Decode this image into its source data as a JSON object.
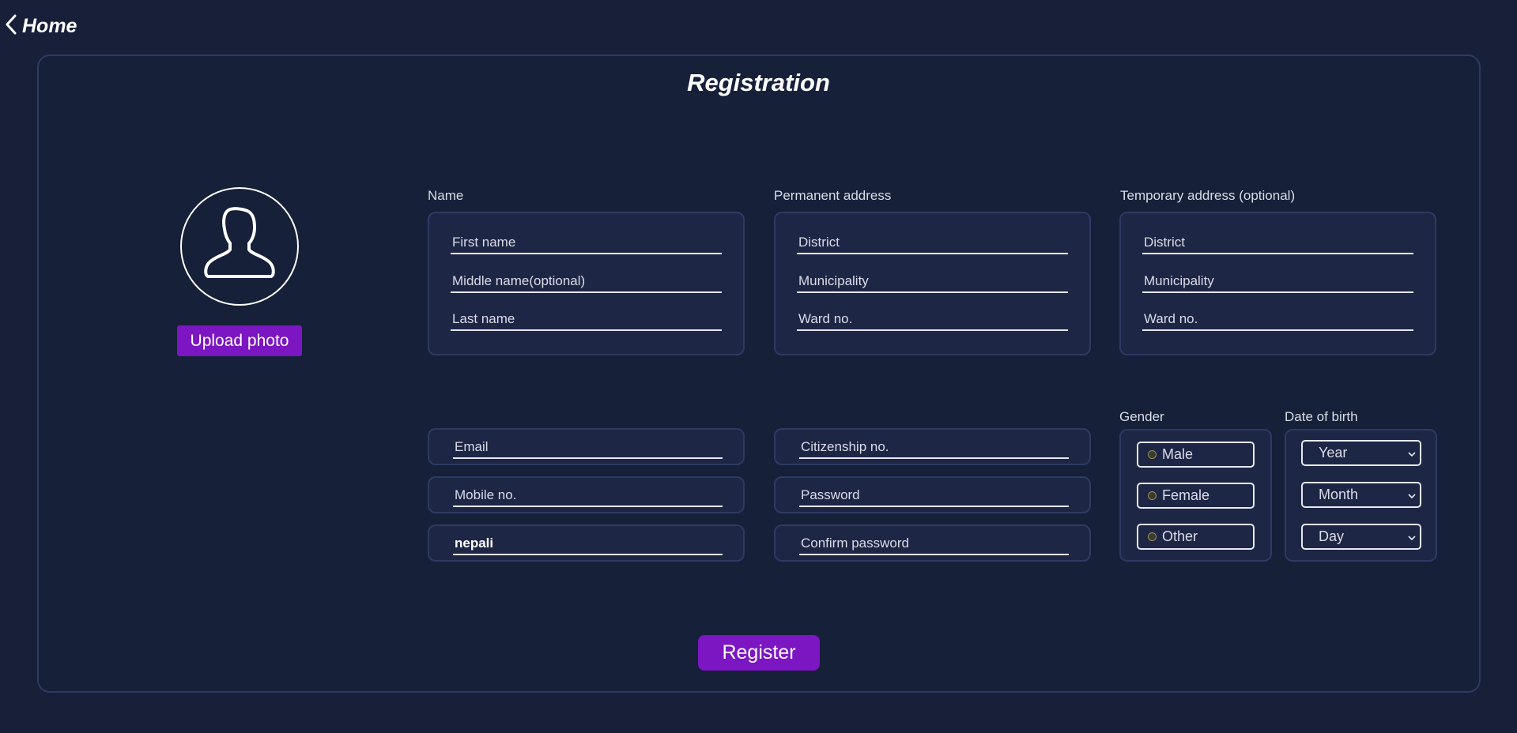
{
  "header": {
    "home_label": "Home"
  },
  "form": {
    "title": "Registration",
    "upload_label": "Upload photo",
    "register_label": "Register",
    "name_section": {
      "label": "Name",
      "first": "First name",
      "middle": "Middle name(optional)",
      "last": "Last name"
    },
    "permanent_section": {
      "label": "Permanent address",
      "district": "District",
      "municipality": "Municipality",
      "ward": "Ward no."
    },
    "temporary_section": {
      "label": "Temporary address (optional)",
      "district": "District",
      "municipality": "Municipality",
      "ward": "Ward no."
    },
    "contact": {
      "email": "Email",
      "mobile": "Mobile no.",
      "nationality_value": "nepali",
      "citizenship": "Citizenship no.",
      "password": "Password",
      "confirm_password": "Confirm password"
    },
    "gender": {
      "label": "Gender",
      "options": [
        "Male",
        "Female",
        "Other"
      ]
    },
    "dob": {
      "label": "Date of birth",
      "year": "Year",
      "month": "Month",
      "day": "Day"
    }
  },
  "icons": {
    "back": "chevron-left-icon",
    "avatar": "user-silhouette-icon",
    "dropdown": "chevron-down-icon"
  },
  "colors": {
    "background": "#181f39",
    "panel": "#1e2646",
    "border": "#2e3a63",
    "accent": "#7b16c2"
  }
}
